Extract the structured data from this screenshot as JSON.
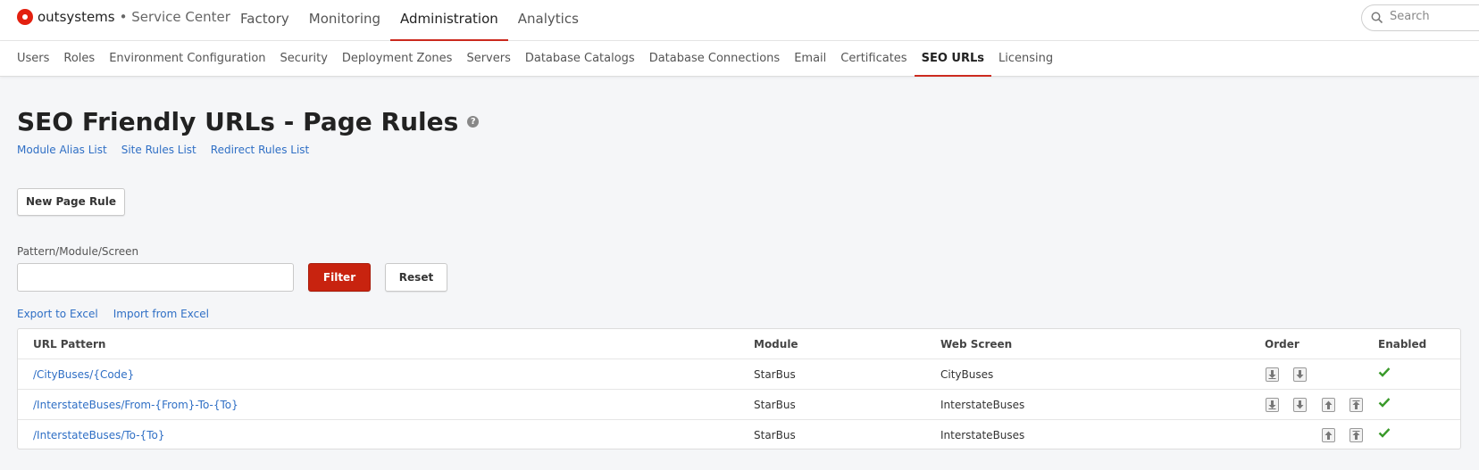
{
  "header": {
    "brand": "outsystems",
    "brand_sub": "• Service Center",
    "nav": [
      "Factory",
      "Monitoring",
      "Administration",
      "Analytics"
    ],
    "active_nav": "Administration",
    "search_placeholder": "Search"
  },
  "subnav": {
    "items": [
      "Users",
      "Roles",
      "Environment Configuration",
      "Security",
      "Deployment Zones",
      "Servers",
      "Database Catalogs",
      "Database Connections",
      "Email",
      "Certificates",
      "SEO URLs",
      "Licensing"
    ],
    "active": "SEO URLs"
  },
  "page": {
    "title": "SEO Friendly URLs - Page Rules",
    "help_glyph": "?",
    "links": [
      "Module Alias List",
      "Site Rules List",
      "Redirect Rules List"
    ],
    "new_button": "New Page Rule",
    "filter_label": "Pattern/Module/Screen",
    "filter_value": "",
    "filter_button": "Filter",
    "reset_button": "Reset",
    "export_link": "Export to Excel",
    "import_link": "Import from Excel"
  },
  "table": {
    "headers": {
      "url": "URL Pattern",
      "module": "Module",
      "screen": "Web Screen",
      "order": "Order",
      "enabled": "Enabled"
    },
    "rows": [
      {
        "url": "/CityBuses/{Code}",
        "module": "StarBus",
        "screen": "CityBuses",
        "order_buttons": [
          "move-bottom",
          "move-down"
        ],
        "enabled": true
      },
      {
        "url": "/InterstateBuses/From-{From}-To-{To}",
        "module": "StarBus",
        "screen": "InterstateBuses",
        "order_buttons": [
          "move-bottom",
          "move-down",
          "move-up",
          "move-top"
        ],
        "enabled": true
      },
      {
        "url": "/InterstateBuses/To-{To}",
        "module": "StarBus",
        "screen": "InterstateBuses",
        "order_buttons": [
          "move-up",
          "move-top"
        ],
        "enabled": true
      }
    ]
  },
  "colors": {
    "accent": "#cc2a1f",
    "link": "#2f6fc5",
    "filter_button": "#c8230f",
    "check": "#3a9a2a"
  }
}
